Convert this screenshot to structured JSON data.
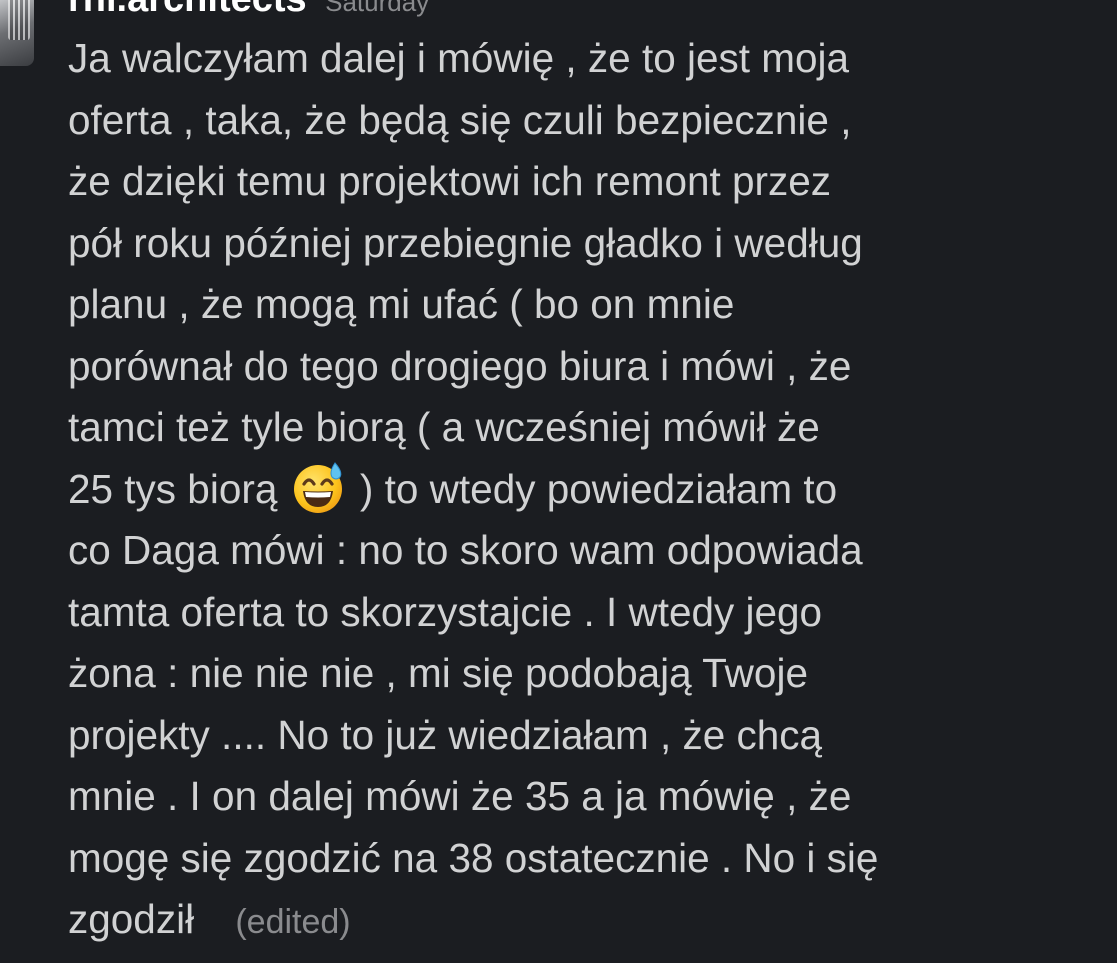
{
  "message": {
    "sender": "rhi.architects",
    "timestamp": "Saturday",
    "lines": [
      "Ja walczyłam dalej i mówię , że to jest moja",
      "oferta , taka, że będą się czuli bezpiecznie ,",
      "że dzięki temu projektowi ich remont przez",
      "pół roku później przebiegnie gładko i według",
      "planu , że mogą mi ufać ( bo on mnie",
      "porównał do tego drogiego biura i mówi , że",
      "tamci też tyle biorą ( a wcześniej mówił że"
    ],
    "line8_before_emoji": "25 tys biorą",
    "emoji": "grinning-face-with-sweat",
    "line8_after_emoji": ") to wtedy powiedziałam to",
    "lines_after": [
      "co Daga mówi : no to skoro wam odpowiada",
      "tamta oferta to skorzystajcie . I wtedy jego",
      "żona : nie nie nie , mi się podobają Twoje",
      "projekty .... No to już wiedziałam , że chcą",
      "mnie . I on dalej mówi że 35 a ja mówię , że",
      "mogę się zgodzić na 38 ostatecznie . No i się"
    ],
    "last_line": "zgodził",
    "edited_label": "(edited)"
  },
  "colors": {
    "background": "#1b1d21",
    "text": "#d1d2d3",
    "muted": "#8a8b8e",
    "sender": "#ffffff"
  }
}
